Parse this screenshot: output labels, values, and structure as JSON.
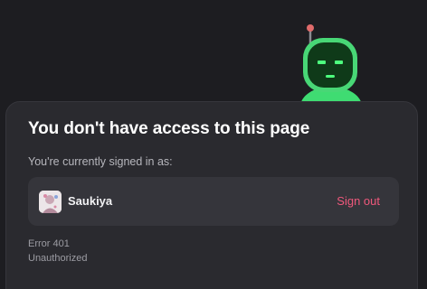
{
  "page": {
    "title": "You don't have access to this page",
    "signed_in_label": "You're currently signed in as:"
  },
  "account": {
    "username": "Saukiya",
    "avatar_icon": "user-avatar",
    "sign_out_label": "Sign out"
  },
  "error": {
    "code_label": "Error 401",
    "status_text": "Unauthorized"
  },
  "mascot": {
    "icon": "robot-icon"
  },
  "colors": {
    "background": "#1d1d21",
    "card": "#2a2a2f",
    "row": "#35353b",
    "accent_pink": "#f0587c",
    "robot_green": "#3fdc72",
    "robot_face": "#0f3a19"
  }
}
